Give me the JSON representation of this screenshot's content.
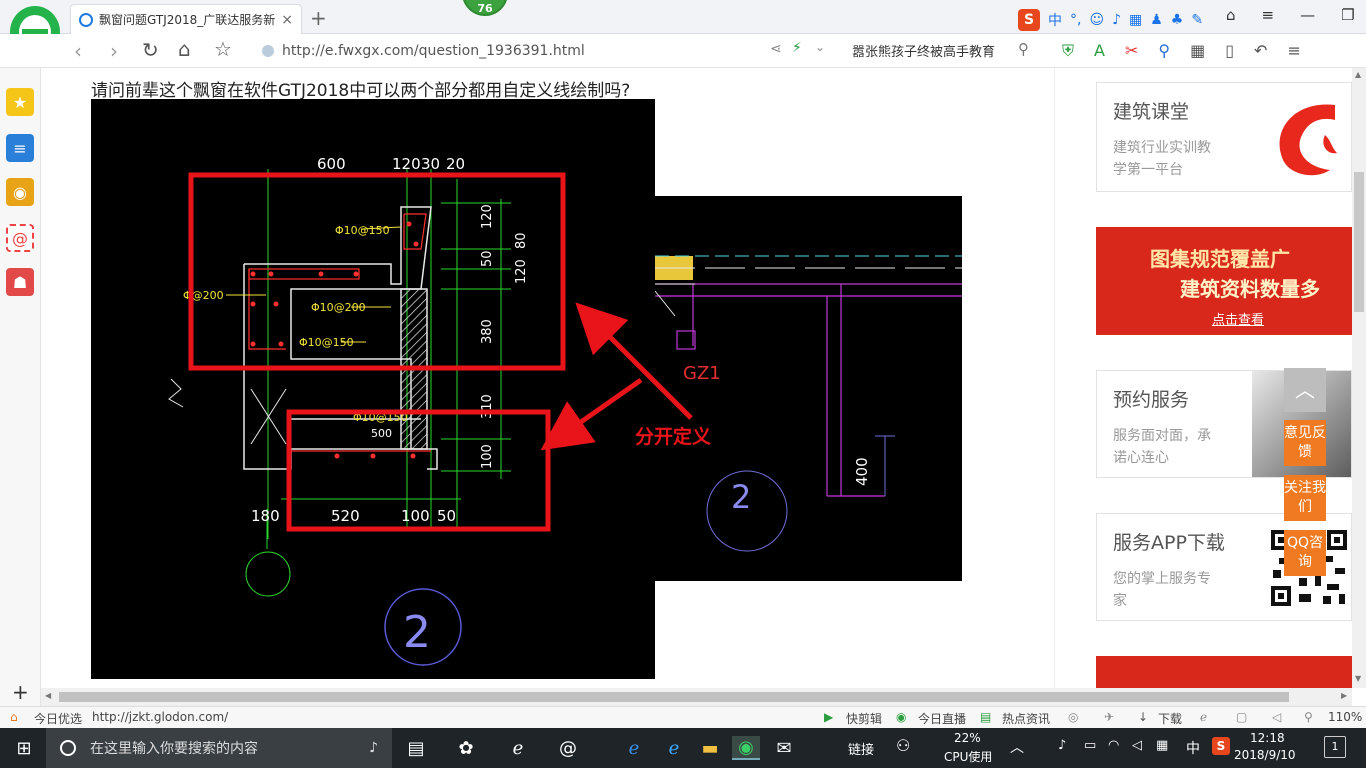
{
  "browser": {
    "tab_title": "飘窗问题GTJ2018_广联达服务新",
    "tab_close": "×",
    "new_tab": "+",
    "badge_count": "76",
    "url": "http://e.fwxgx.com/question_1936391.html",
    "search_hint": "嚣张熊孩子终被高手教育",
    "ime_label": "中",
    "ime_logo": "S"
  },
  "page": {
    "question": "请问前辈这个飘窗在软件GTJ2018中可以两个部分都用自定义线绘制吗?",
    "annotation": "分开定义",
    "cad_labels": {
      "top_dims": [
        "600",
        "120",
        "30",
        "20"
      ],
      "right_dims": [
        "120",
        "50",
        "120",
        "80",
        "380",
        "310",
        "100"
      ],
      "bottom_dims": [
        "180",
        "520",
        "100",
        "50"
      ],
      "rebar": [
        "Φ10@150",
        "Φ@200",
        "Φ10@200",
        "Φ10@150",
        "Φ10@150"
      ],
      "axis_mark": "2",
      "gz": "GZ1",
      "dim400": "400"
    }
  },
  "right_panel": {
    "cards": [
      {
        "title": "建筑课堂",
        "desc": "建筑行业实训教学第一平台"
      },
      {
        "title": "预约服务",
        "desc": "服务面对面，承诺心连心"
      },
      {
        "title": "服务APP下载",
        "desc": "您的掌上服务专家"
      }
    ],
    "banner": {
      "line1": "图集规范覆盖广",
      "line2": "建筑资料数量多",
      "cta": "点击查看"
    },
    "floats": [
      {
        "label": "意见反馈"
      },
      {
        "label": "关注我们"
      },
      {
        "label": "QQ咨询"
      }
    ]
  },
  "statusbar": {
    "left_label": "今日优选",
    "url": "http://jzkt.glodon.com/",
    "items": [
      "快剪辑",
      "今日直播",
      "热点资讯",
      "下载"
    ],
    "zoom": "110%"
  },
  "taskbar": {
    "search_placeholder": "在这里输入你要搜索的内容",
    "link_label": "链接",
    "cpu_percent": "22%",
    "cpu_label": "CPU使用",
    "ime": "中",
    "time": "12:18",
    "date": "2018/9/10",
    "notif_count": "1"
  },
  "colors": {
    "cad_bg": "#000000",
    "highlight_red": "#e8141a",
    "accent_orange": "#f07a22",
    "brand_green": "#2a9d3e"
  }
}
